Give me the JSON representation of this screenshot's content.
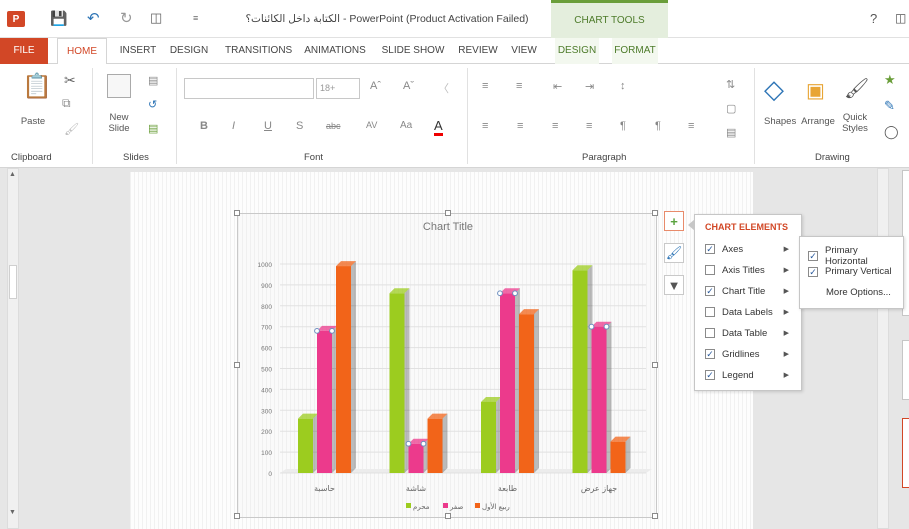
{
  "window": {
    "title": "الكتابة داخل الكائنات؟ - PowerPoint (Product Activation Failed)",
    "contextual_group": "CHART TOOLS",
    "help": "?",
    "app_icon_letter": "P"
  },
  "tabs": [
    "FILE",
    "HOME",
    "INSERT",
    "DESIGN",
    "TRANSITIONS",
    "ANIMATIONS",
    "SLIDE SHOW",
    "REVIEW",
    "VIEW",
    "DESIGN",
    "FORMAT"
  ],
  "ribbon": {
    "clipboard": {
      "label": "Clipboard",
      "paste": "Paste"
    },
    "slides": {
      "label": "Slides",
      "new_slide": "New\nSlide"
    },
    "font": {
      "label": "Font",
      "size": "18+"
    },
    "paragraph": {
      "label": "Paragraph"
    },
    "drawing": {
      "label": "Drawing",
      "shapes": "Shapes",
      "arrange": "Arrange",
      "quick_styles": "Quick\nStyles"
    }
  },
  "chart_elements": {
    "title": "CHART ELEMENTS",
    "items": [
      {
        "label": "Axes",
        "checked": true
      },
      {
        "label": "Axis Titles",
        "checked": false
      },
      {
        "label": "Chart Title",
        "checked": true
      },
      {
        "label": "Data Labels",
        "checked": false
      },
      {
        "label": "Data Table",
        "checked": false
      },
      {
        "label": "Gridlines",
        "checked": true
      },
      {
        "label": "Legend",
        "checked": true
      }
    ]
  },
  "axes_submenu": {
    "items": [
      {
        "label": "Primary Horizontal",
        "checked": true
      },
      {
        "label": "Primary Vertical",
        "checked": true
      },
      {
        "label": "More Options...",
        "checked": null
      }
    ]
  },
  "chart_data": {
    "type": "bar",
    "title": "Chart Title",
    "categories": [
      "حاسبة",
      "شاشة",
      "طابعة",
      "جهاز عرض"
    ],
    "series": [
      {
        "name": "محرم",
        "values": [
          260,
          860,
          340,
          970
        ],
        "color": "#9ccc1f"
      },
      {
        "name": "صفر",
        "values": [
          680,
          140,
          860,
          700
        ],
        "color": "#ec3a8c"
      },
      {
        "name": "ربيع الأول",
        "values": [
          990,
          260,
          760,
          150
        ],
        "color": "#f26419"
      }
    ],
    "ylim": [
      0,
      1000
    ],
    "yticks": [
      0,
      100,
      200,
      300,
      400,
      500,
      600,
      700,
      800,
      900,
      1000
    ],
    "legend_position": "bottom",
    "grid": true
  }
}
